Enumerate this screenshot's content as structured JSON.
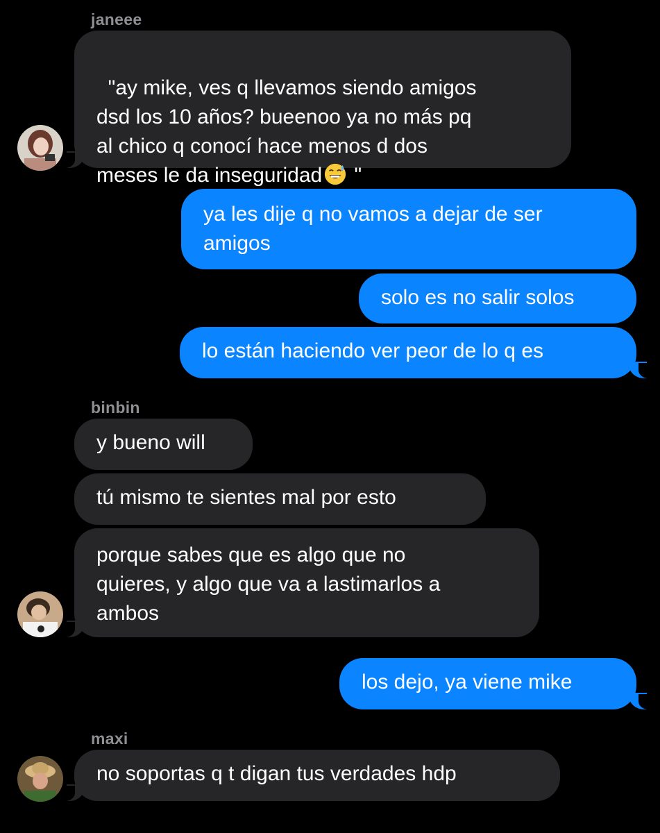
{
  "colors": {
    "background": "#000000",
    "incoming_bubble": "#262628",
    "outgoing_bubble": "#0a84ff",
    "sender_name": "#8e8e93",
    "text": "#ffffff"
  },
  "messages": [
    {
      "sender": "janeee",
      "direction": "incoming",
      "avatar": "janeee-avatar",
      "text_before_emoji": "\"ay mike, ves q llevamos siendo amigos\ndsd los 10 años? bueenoo ya no más pq\nal chico q conocí hace menos d dos\nmeses le da inseguridad",
      "emoji": "grinning-sweat-emoji",
      "text_after_emoji": " \""
    },
    {
      "direction": "outgoing",
      "text": "ya les dije q no vamos a dejar de ser\namigos"
    },
    {
      "direction": "outgoing",
      "text": "solo es no salir solos"
    },
    {
      "direction": "outgoing",
      "text": "lo están haciendo ver peor de lo q es"
    },
    {
      "sender": "binbin",
      "direction": "incoming",
      "text": "y bueno will"
    },
    {
      "direction": "incoming",
      "text": "tú mismo te sientes mal por esto"
    },
    {
      "direction": "incoming",
      "avatar": "binbin-avatar",
      "text": "porque sabes que es algo que no\nquieres, y algo que va a lastimarlos a\nambos"
    },
    {
      "direction": "outgoing",
      "text": "los dejo, ya viene mike"
    },
    {
      "sender": "maxi",
      "direction": "incoming",
      "avatar": "maxi-avatar",
      "text": "no soportas q t digan tus verdades hdp"
    }
  ]
}
